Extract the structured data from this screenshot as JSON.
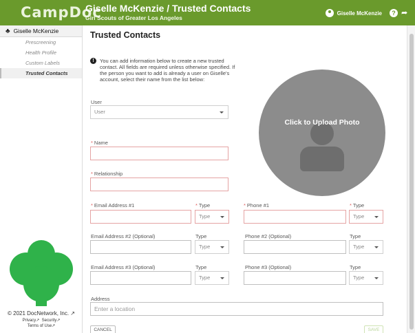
{
  "app": {
    "logo_text": "CampDoc",
    "brand_color": "#6a9a2c"
  },
  "header": {
    "title": "Giselle McKenzie / Trusted Contacts",
    "subtitle": "Girl Scouts of Greater Los Angeles",
    "user_name": "Giselle McKenzie",
    "icons": [
      "user-icon",
      "help-icon",
      "logout-icon"
    ]
  },
  "sidebar": {
    "participant": "Giselle McKenzie",
    "items": [
      {
        "label": "Prescreening"
      },
      {
        "label": "Health Profile"
      },
      {
        "label": "Custom Labels"
      },
      {
        "label": "Trusted Contacts",
        "active": true
      }
    ],
    "copyright": "© 2021 DocNetwork, Inc.",
    "links": {
      "privacy": "Privacy",
      "security": "Security",
      "terms": "Terms of Use"
    }
  },
  "main": {
    "title": "Trusted Contacts",
    "info": "You can add information below to create a new trusted contact. All fields are required unless otherwise specified. If the person you want to add is already a user on Giselle's account, select their name from the list below:",
    "user": {
      "label": "User",
      "value": "User"
    },
    "name": {
      "label": "Name",
      "value": ""
    },
    "relationship": {
      "label": "Relationship",
      "value": ""
    },
    "type_label": "Type",
    "type_placeholder": "Type",
    "email1": {
      "label": "Email Address #1"
    },
    "phone1": {
      "label": "Phone #1"
    },
    "email2": {
      "label": "Email Address #2 (Optional)"
    },
    "phone2": {
      "label": "Phone #2 (Optional)"
    },
    "email3": {
      "label": "Email Address #3 (Optional)"
    },
    "phone3": {
      "label": "Phone #3 (Optional)"
    },
    "address": {
      "label": "Address",
      "placeholder": "Enter a location"
    },
    "photo_label": "Click to Upload Photo",
    "cancel_label": "CANCEL",
    "save_label": "SAVE"
  }
}
